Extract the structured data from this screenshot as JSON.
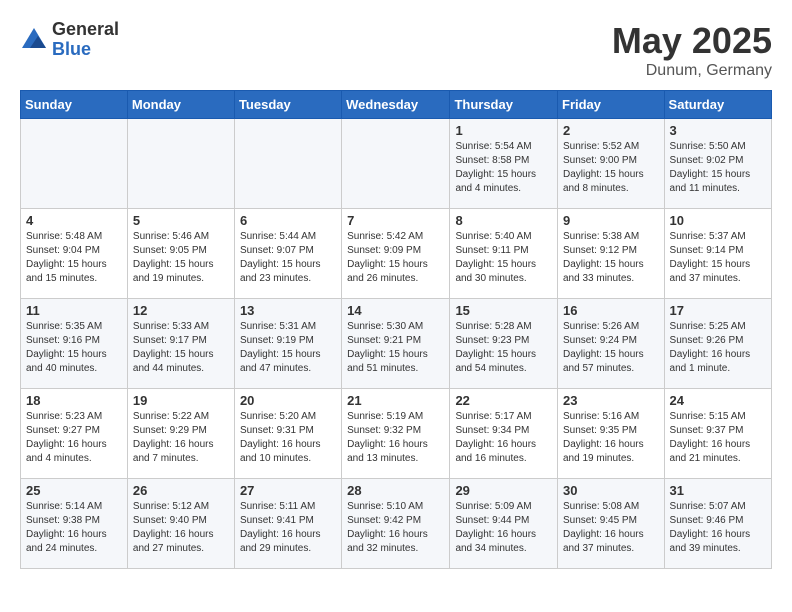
{
  "logo": {
    "general": "General",
    "blue": "Blue"
  },
  "title": {
    "month": "May 2025",
    "location": "Dunum, Germany"
  },
  "weekdays": [
    "Sunday",
    "Monday",
    "Tuesday",
    "Wednesday",
    "Thursday",
    "Friday",
    "Saturday"
  ],
  "weeks": [
    [
      {
        "day": "",
        "info": ""
      },
      {
        "day": "",
        "info": ""
      },
      {
        "day": "",
        "info": ""
      },
      {
        "day": "",
        "info": ""
      },
      {
        "day": "1",
        "info": "Sunrise: 5:54 AM\nSunset: 8:58 PM\nDaylight: 15 hours\nand 4 minutes."
      },
      {
        "day": "2",
        "info": "Sunrise: 5:52 AM\nSunset: 9:00 PM\nDaylight: 15 hours\nand 8 minutes."
      },
      {
        "day": "3",
        "info": "Sunrise: 5:50 AM\nSunset: 9:02 PM\nDaylight: 15 hours\nand 11 minutes."
      }
    ],
    [
      {
        "day": "4",
        "info": "Sunrise: 5:48 AM\nSunset: 9:04 PM\nDaylight: 15 hours\nand 15 minutes."
      },
      {
        "day": "5",
        "info": "Sunrise: 5:46 AM\nSunset: 9:05 PM\nDaylight: 15 hours\nand 19 minutes."
      },
      {
        "day": "6",
        "info": "Sunrise: 5:44 AM\nSunset: 9:07 PM\nDaylight: 15 hours\nand 23 minutes."
      },
      {
        "day": "7",
        "info": "Sunrise: 5:42 AM\nSunset: 9:09 PM\nDaylight: 15 hours\nand 26 minutes."
      },
      {
        "day": "8",
        "info": "Sunrise: 5:40 AM\nSunset: 9:11 PM\nDaylight: 15 hours\nand 30 minutes."
      },
      {
        "day": "9",
        "info": "Sunrise: 5:38 AM\nSunset: 9:12 PM\nDaylight: 15 hours\nand 33 minutes."
      },
      {
        "day": "10",
        "info": "Sunrise: 5:37 AM\nSunset: 9:14 PM\nDaylight: 15 hours\nand 37 minutes."
      }
    ],
    [
      {
        "day": "11",
        "info": "Sunrise: 5:35 AM\nSunset: 9:16 PM\nDaylight: 15 hours\nand 40 minutes."
      },
      {
        "day": "12",
        "info": "Sunrise: 5:33 AM\nSunset: 9:17 PM\nDaylight: 15 hours\nand 44 minutes."
      },
      {
        "day": "13",
        "info": "Sunrise: 5:31 AM\nSunset: 9:19 PM\nDaylight: 15 hours\nand 47 minutes."
      },
      {
        "day": "14",
        "info": "Sunrise: 5:30 AM\nSunset: 9:21 PM\nDaylight: 15 hours\nand 51 minutes."
      },
      {
        "day": "15",
        "info": "Sunrise: 5:28 AM\nSunset: 9:23 PM\nDaylight: 15 hours\nand 54 minutes."
      },
      {
        "day": "16",
        "info": "Sunrise: 5:26 AM\nSunset: 9:24 PM\nDaylight: 15 hours\nand 57 minutes."
      },
      {
        "day": "17",
        "info": "Sunrise: 5:25 AM\nSunset: 9:26 PM\nDaylight: 16 hours\nand 1 minute."
      }
    ],
    [
      {
        "day": "18",
        "info": "Sunrise: 5:23 AM\nSunset: 9:27 PM\nDaylight: 16 hours\nand 4 minutes."
      },
      {
        "day": "19",
        "info": "Sunrise: 5:22 AM\nSunset: 9:29 PM\nDaylight: 16 hours\nand 7 minutes."
      },
      {
        "day": "20",
        "info": "Sunrise: 5:20 AM\nSunset: 9:31 PM\nDaylight: 16 hours\nand 10 minutes."
      },
      {
        "day": "21",
        "info": "Sunrise: 5:19 AM\nSunset: 9:32 PM\nDaylight: 16 hours\nand 13 minutes."
      },
      {
        "day": "22",
        "info": "Sunrise: 5:17 AM\nSunset: 9:34 PM\nDaylight: 16 hours\nand 16 minutes."
      },
      {
        "day": "23",
        "info": "Sunrise: 5:16 AM\nSunset: 9:35 PM\nDaylight: 16 hours\nand 19 minutes."
      },
      {
        "day": "24",
        "info": "Sunrise: 5:15 AM\nSunset: 9:37 PM\nDaylight: 16 hours\nand 21 minutes."
      }
    ],
    [
      {
        "day": "25",
        "info": "Sunrise: 5:14 AM\nSunset: 9:38 PM\nDaylight: 16 hours\nand 24 minutes."
      },
      {
        "day": "26",
        "info": "Sunrise: 5:12 AM\nSunset: 9:40 PM\nDaylight: 16 hours\nand 27 minutes."
      },
      {
        "day": "27",
        "info": "Sunrise: 5:11 AM\nSunset: 9:41 PM\nDaylight: 16 hours\nand 29 minutes."
      },
      {
        "day": "28",
        "info": "Sunrise: 5:10 AM\nSunset: 9:42 PM\nDaylight: 16 hours\nand 32 minutes."
      },
      {
        "day": "29",
        "info": "Sunrise: 5:09 AM\nSunset: 9:44 PM\nDaylight: 16 hours\nand 34 minutes."
      },
      {
        "day": "30",
        "info": "Sunrise: 5:08 AM\nSunset: 9:45 PM\nDaylight: 16 hours\nand 37 minutes."
      },
      {
        "day": "31",
        "info": "Sunrise: 5:07 AM\nSunset: 9:46 PM\nDaylight: 16 hours\nand 39 minutes."
      }
    ]
  ]
}
